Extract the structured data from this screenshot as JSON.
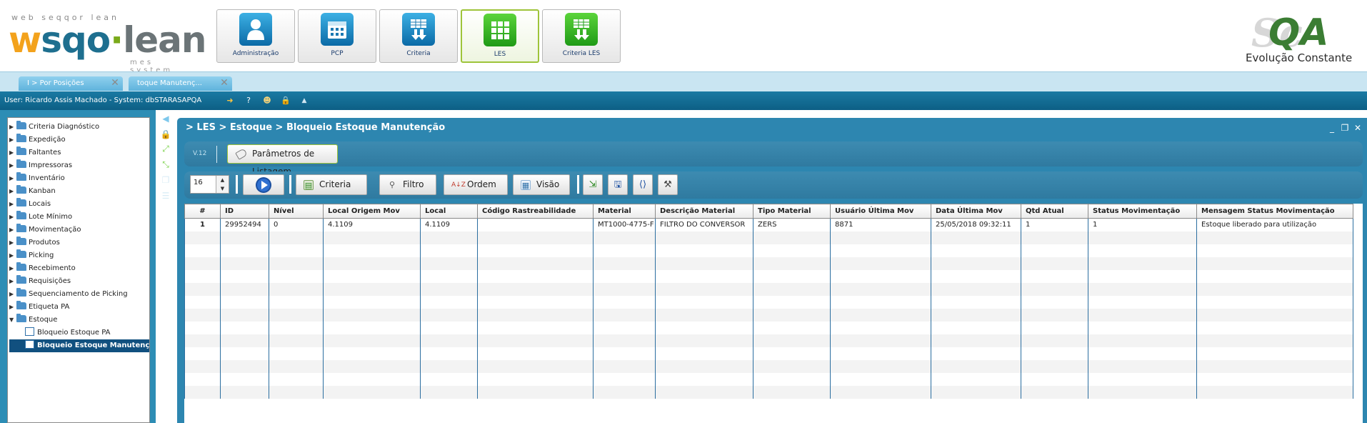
{
  "header": {
    "logo": {
      "tagline": "web seqqor lean",
      "wordmark_w": "w",
      "wordmark_sqo": "sqo",
      "wordmark_dot": "·",
      "wordmark_lean": "lean",
      "subtitle": "mes system"
    },
    "modules": [
      {
        "label": "Administração",
        "icon": "user-icon",
        "color": "blue"
      },
      {
        "label": "PCP",
        "icon": "calendar-icon",
        "color": "blue"
      },
      {
        "label": "Criteria",
        "icon": "table-down-icon",
        "color": "blue"
      },
      {
        "label": "LES",
        "icon": "grid-icon",
        "color": "green",
        "active": true
      },
      {
        "label": "Criteria LES",
        "icon": "table-down-icon",
        "color": "green"
      }
    ],
    "qa_logo": {
      "bg": "Sc",
      "main": "QA",
      "slogan": "Evolução Constante"
    }
  },
  "tabs": [
    {
      "label": "I > Por Posições"
    },
    {
      "label": "toque Manutenç..."
    }
  ],
  "userbar": {
    "text": "User: Ricardo Assis Machado - System: dbSTARASAPQA"
  },
  "tree": {
    "items": [
      {
        "label": "Criteria Diagnóstico",
        "type": "folder",
        "expanded": false
      },
      {
        "label": "Expedição",
        "type": "folder",
        "expanded": false
      },
      {
        "label": "Faltantes",
        "type": "folder",
        "expanded": false
      },
      {
        "label": "Impressoras",
        "type": "folder",
        "expanded": false
      },
      {
        "label": "Inventário",
        "type": "folder",
        "expanded": false
      },
      {
        "label": "Kanban",
        "type": "folder",
        "expanded": false
      },
      {
        "label": "Locais",
        "type": "folder",
        "expanded": false
      },
      {
        "label": "Lote Mínimo",
        "type": "folder",
        "expanded": false
      },
      {
        "label": "Movimentação",
        "type": "folder",
        "expanded": false
      },
      {
        "label": "Produtos",
        "type": "folder",
        "expanded": false
      },
      {
        "label": "Picking",
        "type": "folder",
        "expanded": false
      },
      {
        "label": "Recebimento",
        "type": "folder",
        "expanded": false
      },
      {
        "label": "Requisições",
        "type": "folder",
        "expanded": false
      },
      {
        "label": "Sequenciamento de Picking",
        "type": "folder",
        "expanded": false
      },
      {
        "label": "Etiqueta PA",
        "type": "folder",
        "expanded": false
      },
      {
        "label": "Estoque",
        "type": "folder",
        "expanded": true
      },
      {
        "label": "Bloqueio Estoque PA",
        "type": "leaf"
      },
      {
        "label": "Bloqueio Estoque Manutençã",
        "type": "leaf",
        "selected": true
      }
    ]
  },
  "window": {
    "title": "> LES > Estoque > Bloqueio Estoque Manutenção",
    "version": "V.12",
    "param_button": "Parâmetros de Listagem"
  },
  "toolbar": {
    "page_size": "16",
    "buttons": {
      "criteria": "Criteria",
      "filtro": "Filtro",
      "ordem": "Ordem",
      "visao": "Visão"
    }
  },
  "grid": {
    "columns": [
      "#",
      "ID",
      "Nível",
      "Local Origem Mov",
      "Local",
      "Código Rastreabilidade",
      "Material",
      "Descrição Material",
      "Tipo Material",
      "Usuário Última Mov",
      "Data Última Mov",
      "Qtd Atual",
      "Status Movimentação",
      "Mensagem Status Movimentação"
    ],
    "rows": [
      [
        "1",
        "29952494",
        "0",
        "4.1109",
        "4.1109",
        "",
        "MT1000-4775-F",
        "FILTRO DO CONVERSOR",
        "ZERS",
        "8871",
        "25/05/2018 09:32:11",
        "1",
        "1",
        "Estoque liberado para utilização"
      ]
    ]
  },
  "colors": {
    "accent_blue": "#2d86b0",
    "selected_row": "#11507f",
    "active_module_border": "#9ec43a"
  }
}
